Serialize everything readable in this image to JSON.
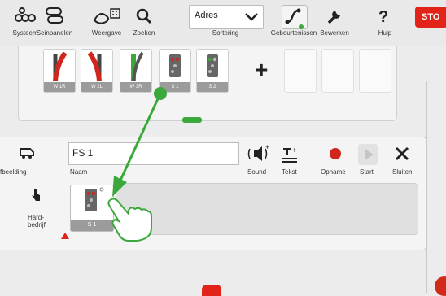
{
  "toolbar": {
    "items": [
      {
        "label": "Systeem",
        "icon": "game-pad-icon"
      },
      {
        "label": "Seinpanelen",
        "icon": "track-layout-icon"
      },
      {
        "label": "Weergave",
        "icon": "view-icon"
      },
      {
        "label": "Zoeken",
        "icon": "search-icon"
      },
      {
        "label": "Gebeurtenissen",
        "icon": "event-curve-icon"
      },
      {
        "label": "Bewerken",
        "icon": "wrench-icon"
      },
      {
        "label": "Hulp",
        "icon": "help-icon"
      }
    ],
    "sort_value": "Adres",
    "sort_label": "Sortering",
    "stop_label": "STO"
  },
  "palette": {
    "tiles": [
      {
        "label": "W 1R",
        "icon": "turnout-right-icon"
      },
      {
        "label": "W 2L",
        "icon": "turnout-left-icon"
      },
      {
        "label": "W 3R",
        "icon": "turnout-right-green-icon"
      },
      {
        "label": "S 1",
        "icon": "signal-icon"
      },
      {
        "label": "S 2",
        "icon": "signal-icon"
      }
    ],
    "add_symbol": "+"
  },
  "editor": {
    "image_label": "fbeelding",
    "name_value": "FS 1",
    "name_label": "Naam",
    "buttons": [
      {
        "label": "Sound",
        "icon": "sound-icon"
      },
      {
        "label": "Tekst",
        "icon": "text-icon"
      },
      {
        "label": "Opname",
        "icon": "record-icon"
      },
      {
        "label": "Start",
        "icon": "play-icon"
      },
      {
        "label": "Sluiten",
        "icon": "close-icon"
      }
    ],
    "mode_label_1": "Hard-",
    "mode_label_2": "bedrijf",
    "sequence_tile_label": "S 1"
  },
  "colors": {
    "accent_green": "#3aa83a",
    "stop_red": "#e2231a",
    "turnout_red": "#d0261d"
  }
}
